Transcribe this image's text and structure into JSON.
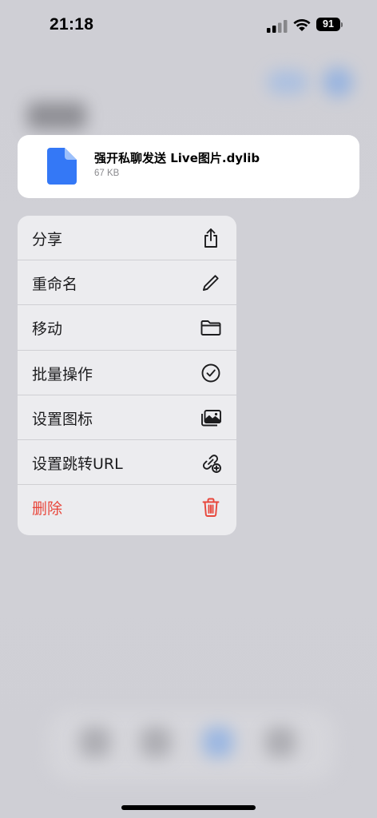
{
  "status_bar": {
    "time": "21:18",
    "battery": "91"
  },
  "file": {
    "name": "强开私聊发送 Live图片.dylib",
    "size": "67 KB",
    "icon": "document-icon",
    "icon_color": "#3478f6"
  },
  "menu": {
    "items": [
      {
        "label": "分享",
        "icon": "share-icon",
        "destructive": false
      },
      {
        "label": "重命名",
        "icon": "pencil-icon",
        "destructive": false
      },
      {
        "label": "移动",
        "icon": "folder-icon",
        "destructive": false
      },
      {
        "label": "批量操作",
        "icon": "checkmark-circle-icon",
        "destructive": false
      },
      {
        "label": "设置图标",
        "icon": "photos-icon",
        "destructive": false
      },
      {
        "label": "设置跳转URL",
        "icon": "link-add-icon",
        "destructive": false
      },
      {
        "label": "删除",
        "icon": "trash-icon",
        "destructive": true
      }
    ]
  },
  "colors": {
    "destructive": "#e8463b",
    "accent": "#3478f6"
  }
}
